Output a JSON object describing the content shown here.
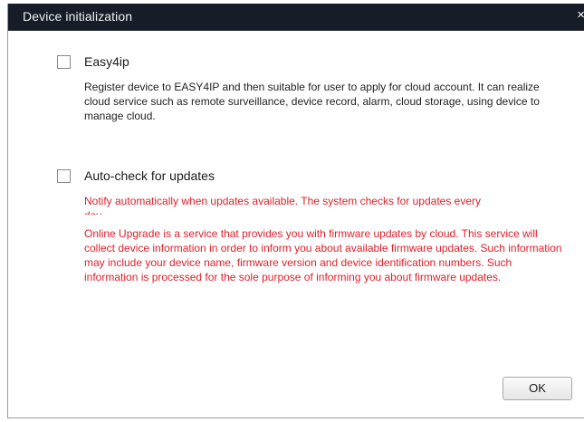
{
  "dialog": {
    "title": "Device initialization",
    "close_glyph": "×"
  },
  "easy4ip": {
    "label": "Easy4ip",
    "checked": false,
    "description": "Register device to EASY4IP and then suitable for user to apply for cloud account. It can realize cloud service such as remote surveillance, device record, alarm, cloud storage, using device to manage cloud."
  },
  "auto_check": {
    "label": "Auto-check for updates",
    "checked": false,
    "notify_line": "Notify automatically when updates available. The system checks for updates every",
    "notify_clipped": "day.",
    "upgrade_text": "Online Upgrade is a service that provides you with firmware updates by cloud. This service will collect device information in order to inform you about available firmware updates. Such information may include your device name, firmware version and device identification numbers. Such information is processed for the sole purpose of informing you about firmware updates."
  },
  "buttons": {
    "ok": "OK"
  },
  "colors": {
    "titlebar": "#161c28",
    "warning_text": "#e0202a"
  }
}
